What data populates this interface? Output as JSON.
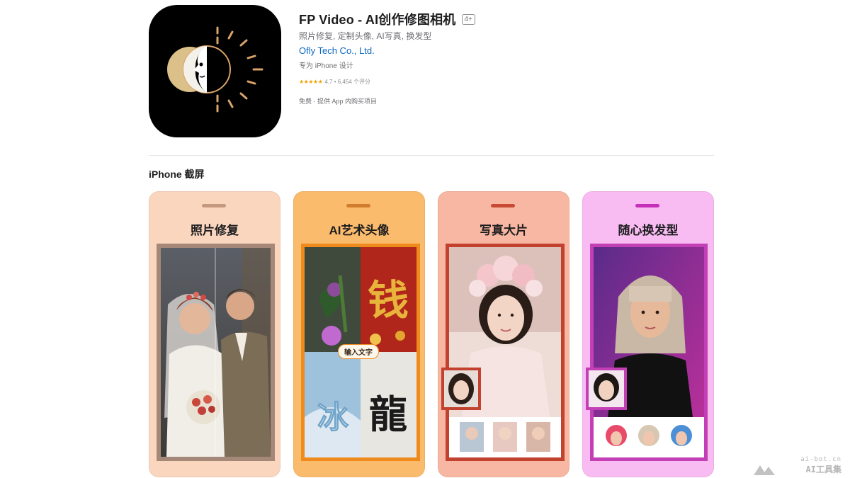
{
  "app": {
    "title": "FP Video - AI创作修图相机",
    "age_rating": "4+",
    "subtitle": "照片修复, 定制头像, AI写真, 换发型",
    "developer": "Ofly Tech Co., Ltd.",
    "designed_for": "专为 iPhone 设计",
    "rating_stars": "★★★★★",
    "rating_text": "4.7 • 6,454 个评分",
    "price": "免费 · 提供 App 内购买项目"
  },
  "screenshots_section": {
    "title": "iPhone 截屏",
    "shots": [
      {
        "caption": "照片修复"
      },
      {
        "caption": "AI艺术头像",
        "chip": "输入文字"
      },
      {
        "caption": "写真大片"
      },
      {
        "caption": "随心换发型"
      }
    ]
  },
  "watermark": {
    "url": "ai-bot.cn",
    "name": "AI工具集"
  },
  "colors": {
    "link": "#0a66c2",
    "star": "#f0a000",
    "shot1_bg": "#fbd6bf",
    "shot2_bg": "#fbbb6c",
    "shot3_bg": "#f8b7a2",
    "shot4_bg": "#f8bcf3"
  },
  "icons": [
    "app-logo-icon",
    "star-icon"
  ]
}
